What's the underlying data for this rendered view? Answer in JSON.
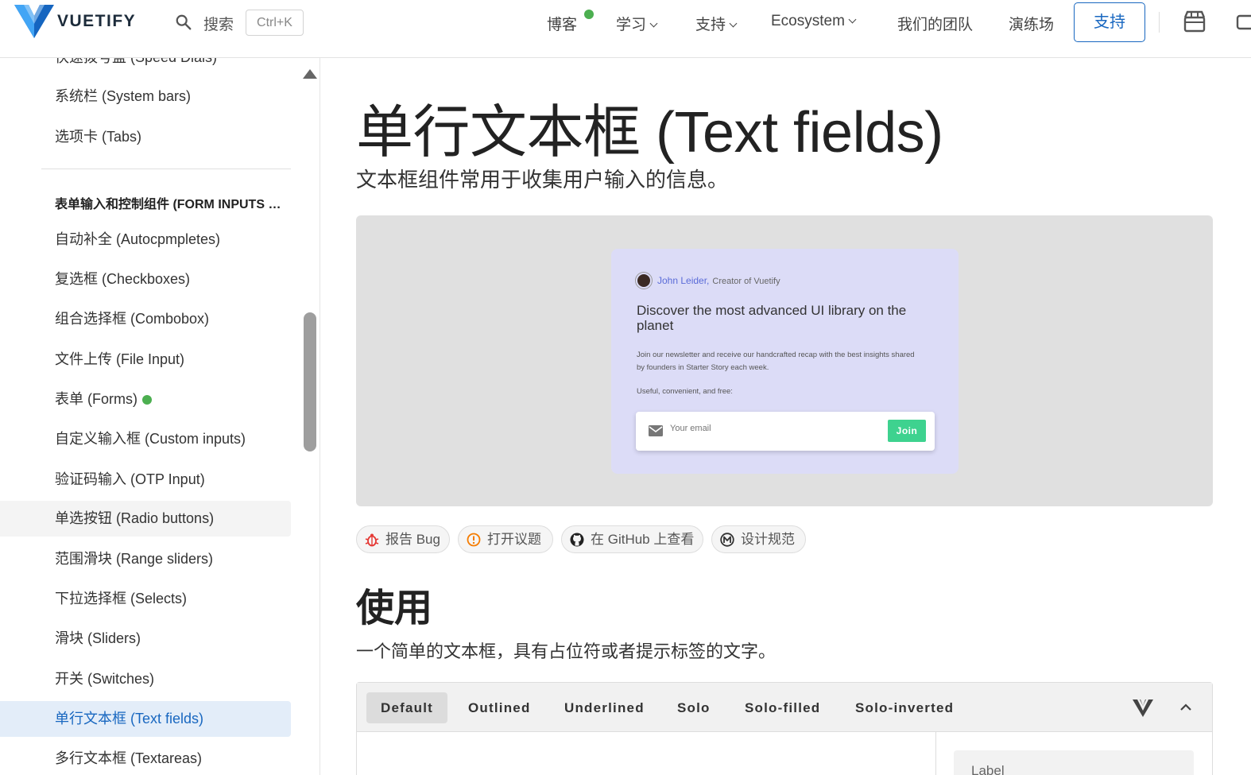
{
  "header": {
    "brand": "VUETIFY",
    "search_label": "搜索",
    "search_shortcut": "Ctrl+K",
    "nav": {
      "blog": "博客",
      "learn": "学习",
      "support_menu": "支持",
      "ecosystem": "Ecosystem",
      "team": "我们的团队",
      "playground": "演练场"
    },
    "support_button": "支持",
    "colors": {
      "brand": "#1867c0",
      "logo_light": "#42a5f5",
      "logo_dark": "#1565c0",
      "new_dot": "#4caf50"
    }
  },
  "sidebar": {
    "items_top": [
      {
        "label": "快速拨号盘 (Speed Dials)"
      },
      {
        "label": "系统栏 (System bars)"
      },
      {
        "label": "选项卡 (Tabs)"
      }
    ],
    "section_heading": "表单输入和控制组件 (FORM INPUTS & CONTROLS)",
    "items": [
      {
        "label": "自动补全 (Autocpmpletes)"
      },
      {
        "label": "复选框 (Checkboxes)"
      },
      {
        "label": "组合选择框 (Combobox)"
      },
      {
        "label": "文件上传 (File Input)"
      },
      {
        "label": "表单 (Forms)"
      },
      {
        "label": "自定义输入框 (Custom inputs)"
      },
      {
        "label": "验证码输入 (OTP Input)"
      },
      {
        "label": "单选按钮 (Radio buttons)"
      },
      {
        "label": "范围滑块 (Range sliders)"
      },
      {
        "label": "下拉选择框 (Selects)"
      },
      {
        "label": "滑块 (Sliders)"
      },
      {
        "label": "开关 (Switches)"
      },
      {
        "label": "单行文本框 (Text fields)"
      },
      {
        "label": "多行文本框 (Textareas)"
      }
    ],
    "active_item": "单行文本框 (Text fields)"
  },
  "main": {
    "title": "单行文本框 (Text fields)",
    "subtitle": "文本框组件常用于收集用户输入的信息。",
    "preview_card": {
      "author": "John Leider,",
      "role": "Creator of Vuetify",
      "title": "Discover the most advanced UI library on the planet",
      "body": "Join our newsletter and receive our handcrafted recap with the best insights shared by founders in Starter Story each week.",
      "note": "Useful, convenient, and free:",
      "email_placeholder": "Your email",
      "join_label": "Join",
      "colors": {
        "card_bg": "#dcdcf7",
        "join": "#3ed28f",
        "author": "#5a6bd8"
      }
    },
    "chips": [
      {
        "label": "报告 Bug",
        "icon": "bug-icon"
      },
      {
        "label": "打开议题",
        "icon": "alert-circle-icon"
      },
      {
        "label": "在 GitHub 上查看",
        "icon": "github-icon"
      },
      {
        "label": "设计规范",
        "icon": "material-design-icon"
      }
    ],
    "usage": {
      "title": "使用",
      "description": "一个简单的文本框，具有占位符或者提示标签的文字。"
    },
    "example_tabs": [
      "Default",
      "Outlined",
      "Underlined",
      "Solo",
      "Solo-filled",
      "Solo-inverted"
    ],
    "active_tab": "Default",
    "field_label": "Label"
  }
}
